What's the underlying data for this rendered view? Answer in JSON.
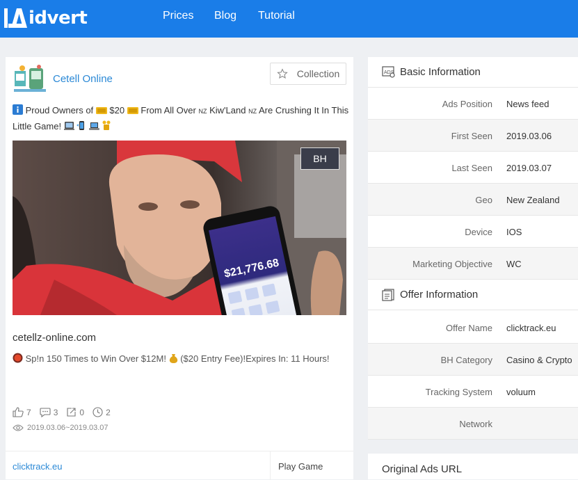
{
  "brand": {
    "logo_text": "idvert",
    "accent": "#1a7de8"
  },
  "nav": {
    "items": [
      "Prices",
      "Blog",
      "Tutorial"
    ]
  },
  "ad": {
    "page_name": "Cetell Online",
    "collection_label": "Collection",
    "headline_parts": [
      "Proud Owners of",
      "$20",
      "From All Over",
      "Kiw'Land",
      "Are Crushing It In This Little Game!"
    ],
    "flag_label": "NZ",
    "badge": "BH",
    "phone_amount": "$21,776.68",
    "domain": "cetellz-online.com",
    "desc_parts": [
      "Sp!n 150 Times to Win Over $12M!",
      "($20 Entry Fee)!Expires In: 11 Hours!"
    ],
    "stats": {
      "likes": "7",
      "comments": "3",
      "shares": "0",
      "time": "2"
    },
    "date_range": "2019.03.06~2019.03.07",
    "footer_link": "clicktrack.eu",
    "cta": "Play Game"
  },
  "basic_info": {
    "title": "Basic Information",
    "rows": [
      {
        "key": "Ads Position",
        "value": "News feed"
      },
      {
        "key": "First Seen",
        "value": "2019.03.06"
      },
      {
        "key": "Last Seen",
        "value": "2019.03.07"
      },
      {
        "key": "Geo",
        "value": "New Zealand"
      },
      {
        "key": "Device",
        "value": "IOS"
      },
      {
        "key": "Marketing Objective",
        "value": "WC"
      }
    ]
  },
  "offer_info": {
    "title": "Offer Information",
    "rows": [
      {
        "key": "Offer Name",
        "value": "clicktrack.eu"
      },
      {
        "key": "BH Category",
        "value": "Casino & Crypto"
      },
      {
        "key": "Tracking System",
        "value": "voluum"
      },
      {
        "key": "Network",
        "value": ""
      }
    ]
  },
  "original_ads": {
    "title": "Original Ads URL"
  }
}
